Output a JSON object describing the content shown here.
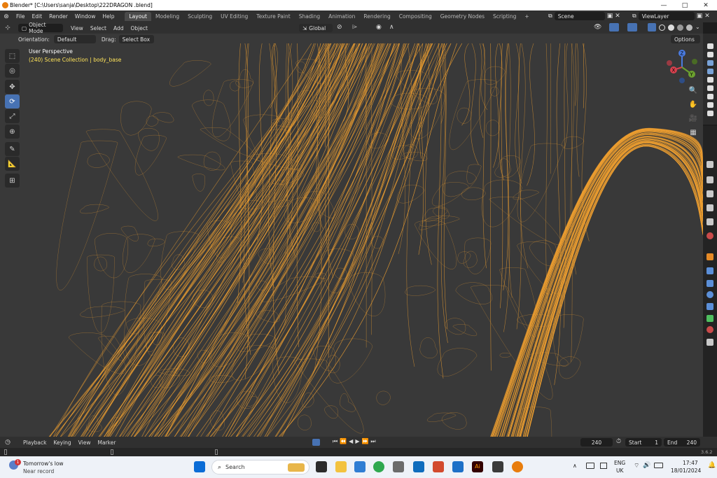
{
  "window": {
    "title": "Blender* [C:\\Users\\sanja\\Desktop\\222DRAGON .blend]",
    "controls": [
      "—",
      "□",
      "✕"
    ]
  },
  "menu": [
    "File",
    "Edit",
    "Render",
    "Window",
    "Help"
  ],
  "workspaces": [
    "Layout",
    "Modeling",
    "Sculpting",
    "UV Editing",
    "Texture Paint",
    "Shading",
    "Animation",
    "Rendering",
    "Compositing",
    "Geometry Nodes",
    "Scripting",
    "+"
  ],
  "scene": {
    "label": "Scene",
    "viewlayer": "ViewLayer"
  },
  "header": {
    "mode": "Object Mode",
    "menus": [
      "View",
      "Select",
      "Add",
      "Object"
    ],
    "transform": "Global",
    "orientation_label": "Orientation:",
    "orientation_value": "Default",
    "drag_label": "Drag:",
    "drag_value": "Select Box",
    "options": "Options"
  },
  "viewport": {
    "perspective": "User Perspective",
    "collection": "(240) Scene Collection | body_base",
    "wire_color": "#f0a030",
    "bg_color": "#393939"
  },
  "gizmo": {
    "x": "X",
    "y": "Y",
    "z": "Z"
  },
  "tools": [
    "select-box",
    "cursor",
    "move",
    "rotate",
    "scale",
    "transform",
    "annotate",
    "measure",
    "add-cube"
  ],
  "timeline": {
    "menus": [
      "Playback",
      "Keying",
      "View",
      "Marker"
    ],
    "current_frame": "240",
    "start_label": "Start",
    "start": "1",
    "end_label": "End",
    "end": "240",
    "version": "3.6.2"
  },
  "taskbar": {
    "weather_title": "Tomorrow's low",
    "weather_sub": "Near record",
    "notification_count": "1",
    "search_placeholder": "Search",
    "lang": "ENG",
    "region": "UK",
    "time": "17:47",
    "date": "18/01/2024"
  }
}
